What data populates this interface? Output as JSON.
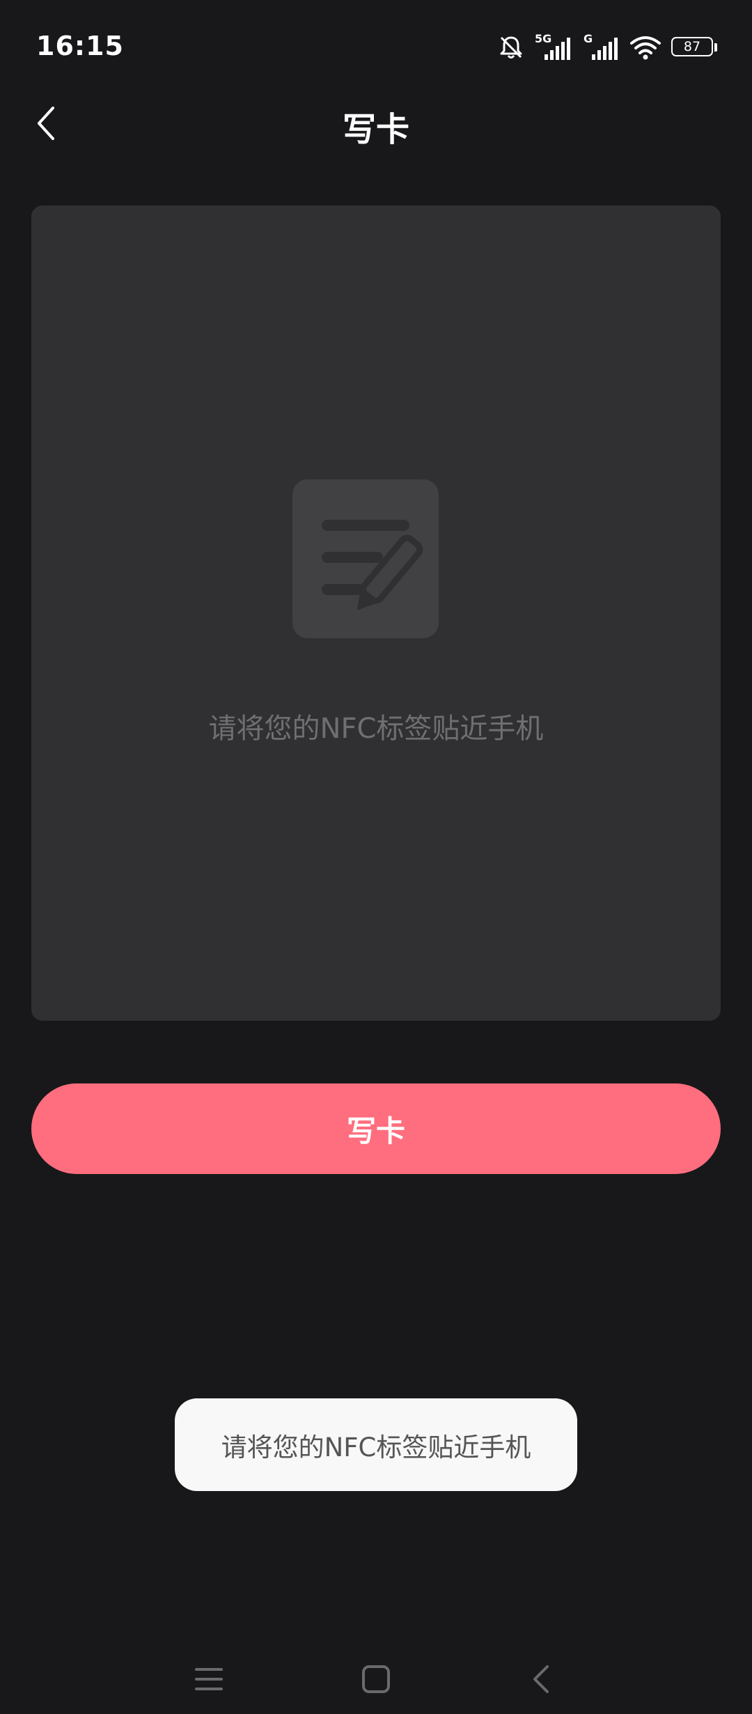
{
  "status_bar": {
    "time": "16:15",
    "battery": "87",
    "icons": [
      "bell-off-icon",
      "signal-5g-icon",
      "signal-g-icon",
      "wifi-icon",
      "battery-icon"
    ],
    "signal_labels": {
      "first": "5G",
      "second": "G"
    }
  },
  "header": {
    "title": "写卡",
    "back_icon": "chevron-left-icon"
  },
  "panel": {
    "icon": "document-edit-icon",
    "hint": "请将您的NFC标签贴近手机"
  },
  "actions": {
    "write_label": "写卡"
  },
  "toast": {
    "message": "请将您的NFC标签贴近手机"
  },
  "nav_bar": {
    "items": [
      "menu-icon",
      "home-icon",
      "back-icon"
    ]
  },
  "colors": {
    "background": "#18181b",
    "panel": "#303032",
    "accent": "#ff6e7e",
    "toast_bg": "#f8f8f8",
    "hint_text": "#6f6f73"
  }
}
